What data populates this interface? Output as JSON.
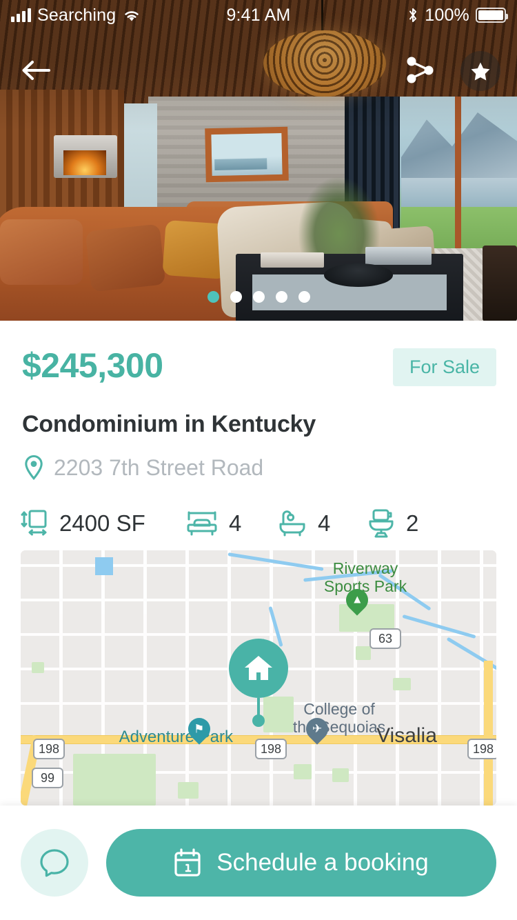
{
  "status_bar": {
    "carrier": "Searching",
    "time": "9:41 AM",
    "battery_percent": "100%",
    "icons": [
      "signal-bars-icon",
      "wifi-icon",
      "bluetooth-icon",
      "battery-icon"
    ]
  },
  "hero": {
    "back_icon": "back-arrow-icon",
    "share_icon": "share-icon",
    "favorite_icon": "star-icon",
    "carousel": {
      "total": 5,
      "active_index": 0
    }
  },
  "listing": {
    "price": "$245,300",
    "status_badge": "For Sale",
    "title": "Condominium in Kentucky",
    "address": "2203 7th Street Road",
    "location_icon": "map-pin-icon",
    "features": [
      {
        "icon": "area-dimensions-icon",
        "value": "2400 SF"
      },
      {
        "icon": "bed-icon",
        "value": "4"
      },
      {
        "icon": "bathtub-icon",
        "value": "4"
      },
      {
        "icon": "toilet-icon",
        "value": "2"
      }
    ]
  },
  "map": {
    "property_marker_icon": "house-marker-icon",
    "labels": [
      {
        "text": "Riverway\nSports Park",
        "type": "park"
      },
      {
        "text": "College of\nthe Sequoias",
        "type": "poi"
      },
      {
        "text": "Visalia",
        "type": "city"
      },
      {
        "text": "Adventure Park",
        "type": "poi-teal"
      }
    ],
    "park_label_line1": "Riverway",
    "park_label_line2": "Sports Park",
    "college_line1": "College of",
    "college_line2": "the Sequoias",
    "city_label": "Visalia",
    "adventure_park_label": "Adventure Park",
    "highway_shields": [
      "63",
      "198",
      "198",
      "198",
      "99"
    ],
    "poi_icons": [
      "tree-pin-icon",
      "playground-pin-icon",
      "school-pin-icon"
    ]
  },
  "bottom_bar": {
    "chat_icon": "chat-bubble-icon",
    "booking_icon": "calendar-icon",
    "booking_label": "Schedule a booking"
  },
  "colors": {
    "accent_teal": "#4db5a8",
    "price_teal": "#48b3a3",
    "badge_bg": "#e1f4f1",
    "title_dark": "#2f3437",
    "address_gray": "#b2b8bd"
  }
}
